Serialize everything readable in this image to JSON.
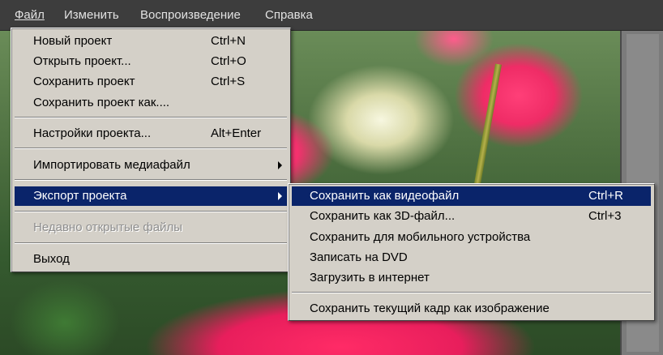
{
  "menubar": {
    "items": [
      {
        "label": "Файл"
      },
      {
        "label": "Изменить"
      },
      {
        "label": "Воспроизведение"
      },
      {
        "label": "Справка"
      }
    ]
  },
  "file_menu": {
    "items": [
      {
        "label": "Новый проект",
        "shortcut": "Ctrl+N"
      },
      {
        "label": "Открыть проект...",
        "shortcut": "Ctrl+O"
      },
      {
        "label": "Сохранить проект",
        "shortcut": "Ctrl+S"
      },
      {
        "label": "Сохранить проект как....",
        "shortcut": ""
      },
      {
        "label": "Настройки проекта...",
        "shortcut": "Alt+Enter"
      },
      {
        "label": "Импортировать медиафайл",
        "shortcut": ""
      },
      {
        "label": "Экспорт проекта",
        "shortcut": ""
      },
      {
        "label": "Недавно открытые файлы",
        "shortcut": ""
      },
      {
        "label": "Выход",
        "shortcut": ""
      }
    ]
  },
  "export_submenu": {
    "items": [
      {
        "label": "Сохранить как видеофайл",
        "shortcut": "Ctrl+R"
      },
      {
        "label": "Сохранить как 3D-файл...",
        "shortcut": "Ctrl+3"
      },
      {
        "label": "Сохранить для мобильного устройства",
        "shortcut": ""
      },
      {
        "label": "Записать на DVD",
        "shortcut": ""
      },
      {
        "label": "Загрузить в интернет",
        "shortcut": ""
      },
      {
        "label": "Сохранить текущий кадр как изображение",
        "shortcut": ""
      }
    ]
  },
  "colors": {
    "highlight": "#0a246a",
    "menu_background": "#d4d0c8",
    "menubar_background": "#3d3d3d"
  }
}
